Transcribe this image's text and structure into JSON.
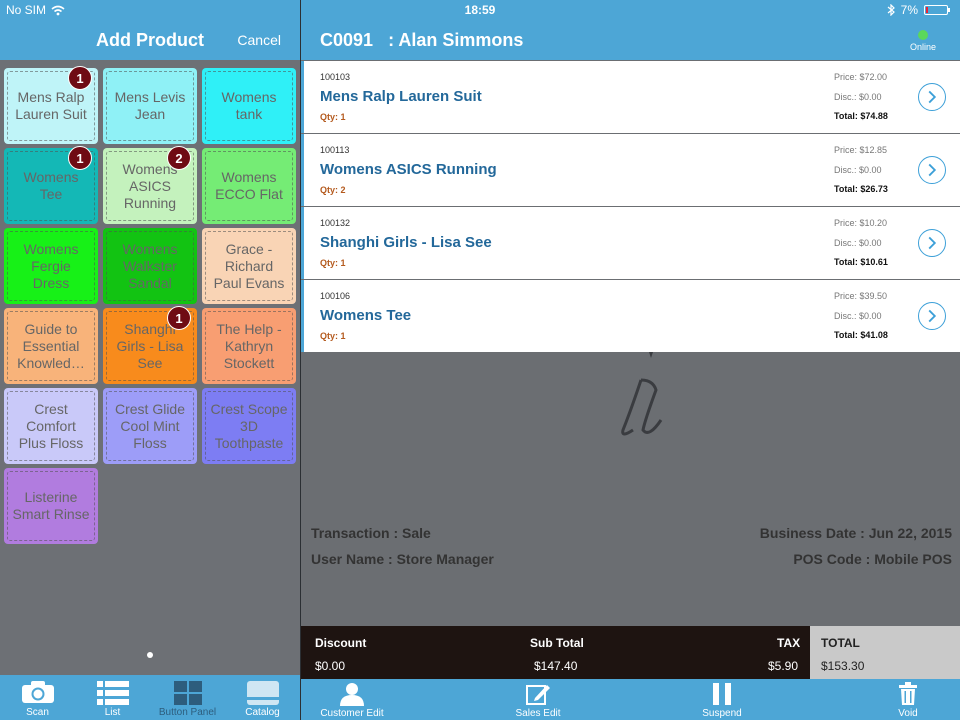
{
  "status_bar": {
    "carrier": "No SIM",
    "time": "18:59",
    "battery": "7%"
  },
  "left_panel": {
    "title": "Add Product",
    "cancel_label": "Cancel",
    "tiles": [
      {
        "label": "Mens Ralp Lauren Suit",
        "badge": "1",
        "color": "#bff4f8"
      },
      {
        "label": "Mens Levis Jean",
        "badge": "",
        "color": "#8ff1f6"
      },
      {
        "label": "Womens tank",
        "badge": "",
        "color": "#2ff0f7"
      },
      {
        "label": "Womens Tee",
        "badge": "1",
        "color": "#14b8b6"
      },
      {
        "label": "Womens ASICS Running",
        "badge": "2",
        "color": "#c4f2bd"
      },
      {
        "label": "Womens ECCO Flat",
        "badge": "",
        "color": "#75ec75"
      },
      {
        "label": "Womens Fergie Dress",
        "badge": "",
        "color": "#17f117"
      },
      {
        "label": "Womens Walkster Sandal",
        "badge": "",
        "color": "#12c312"
      },
      {
        "label": "Grace - Richard Paul Evans",
        "badge": "",
        "color": "#f9d4b5"
      },
      {
        "label": "Guide to Essential Knowled…",
        "badge": "",
        "color": "#f8b37a"
      },
      {
        "label": "Shanghi Girls - Lisa See",
        "badge": "1",
        "color": "#f88b1c"
      },
      {
        "label": "The Help - Kathryn Stockett",
        "badge": "",
        "color": "#f89e72"
      },
      {
        "label": "Crest Comfort Plus Floss",
        "badge": "",
        "color": "#c9c9f9"
      },
      {
        "label": "Crest Glide Cool Mint Floss",
        "badge": "",
        "color": "#9d9df8"
      },
      {
        "label": "Crest Scope 3D Toothpaste",
        "badge": "",
        "color": "#7d7df3"
      },
      {
        "label": "Listerine Smart Rinse",
        "badge": "",
        "color": "#b17cdf"
      }
    ],
    "footer_tabs": [
      {
        "label": "Scan",
        "icon": "camera-icon"
      },
      {
        "label": "List",
        "icon": "list-icon"
      },
      {
        "label": "Button Panel",
        "icon": "grid-icon"
      },
      {
        "label": "Catalog",
        "icon": "catalog-icon"
      }
    ]
  },
  "right_panel": {
    "customer_code": "C0091",
    "customer_name": ": Alan Simmons",
    "online_label": "Online",
    "items": [
      {
        "code": "100103",
        "name": "Mens Ralp Lauren Suit",
        "qty": "Qty: 1",
        "price": "Price: $72.00",
        "disc": "Disc.: $0.00",
        "total": "Total: $74.88"
      },
      {
        "code": "100113",
        "name": "Womens ASICS Running",
        "qty": "Qty: 2",
        "price": "Price: $12.85",
        "disc": "Disc.: $0.00",
        "total": "Total: $26.73"
      },
      {
        "code": "100132",
        "name": "Shanghi Girls - Lisa See",
        "qty": "Qty: 1",
        "price": "Price: $10.20",
        "disc": "Disc.: $0.00",
        "total": "Total: $10.61"
      },
      {
        "code": "100106",
        "name": "Womens Tee",
        "qty": "Qty: 1",
        "price": "Price: $39.50",
        "disc": "Disc.: $0.00",
        "total": "Total: $41.08"
      }
    ],
    "transaction": "Transaction : Sale",
    "user_name": "User Name : Store Manager",
    "business_date": "Business Date : Jun 22, 2015",
    "pos_code": "POS Code : Mobile POS",
    "totals": {
      "discount_label": "Discount",
      "discount_value": "$0.00",
      "subtotal_label": "Sub Total",
      "subtotal_value": "$147.40",
      "tax_label": "TAX",
      "tax_value": "$5.90",
      "total_label": "TOTAL",
      "total_value": "$153.30"
    },
    "footer_buttons": [
      {
        "label": "Customer Edit",
        "icon": "person-icon"
      },
      {
        "label": "Sales Edit",
        "icon": "edit-icon"
      },
      {
        "label": "Suspend",
        "icon": "pause-icon"
      },
      {
        "label": "Void",
        "icon": "trash-icon"
      }
    ]
  }
}
